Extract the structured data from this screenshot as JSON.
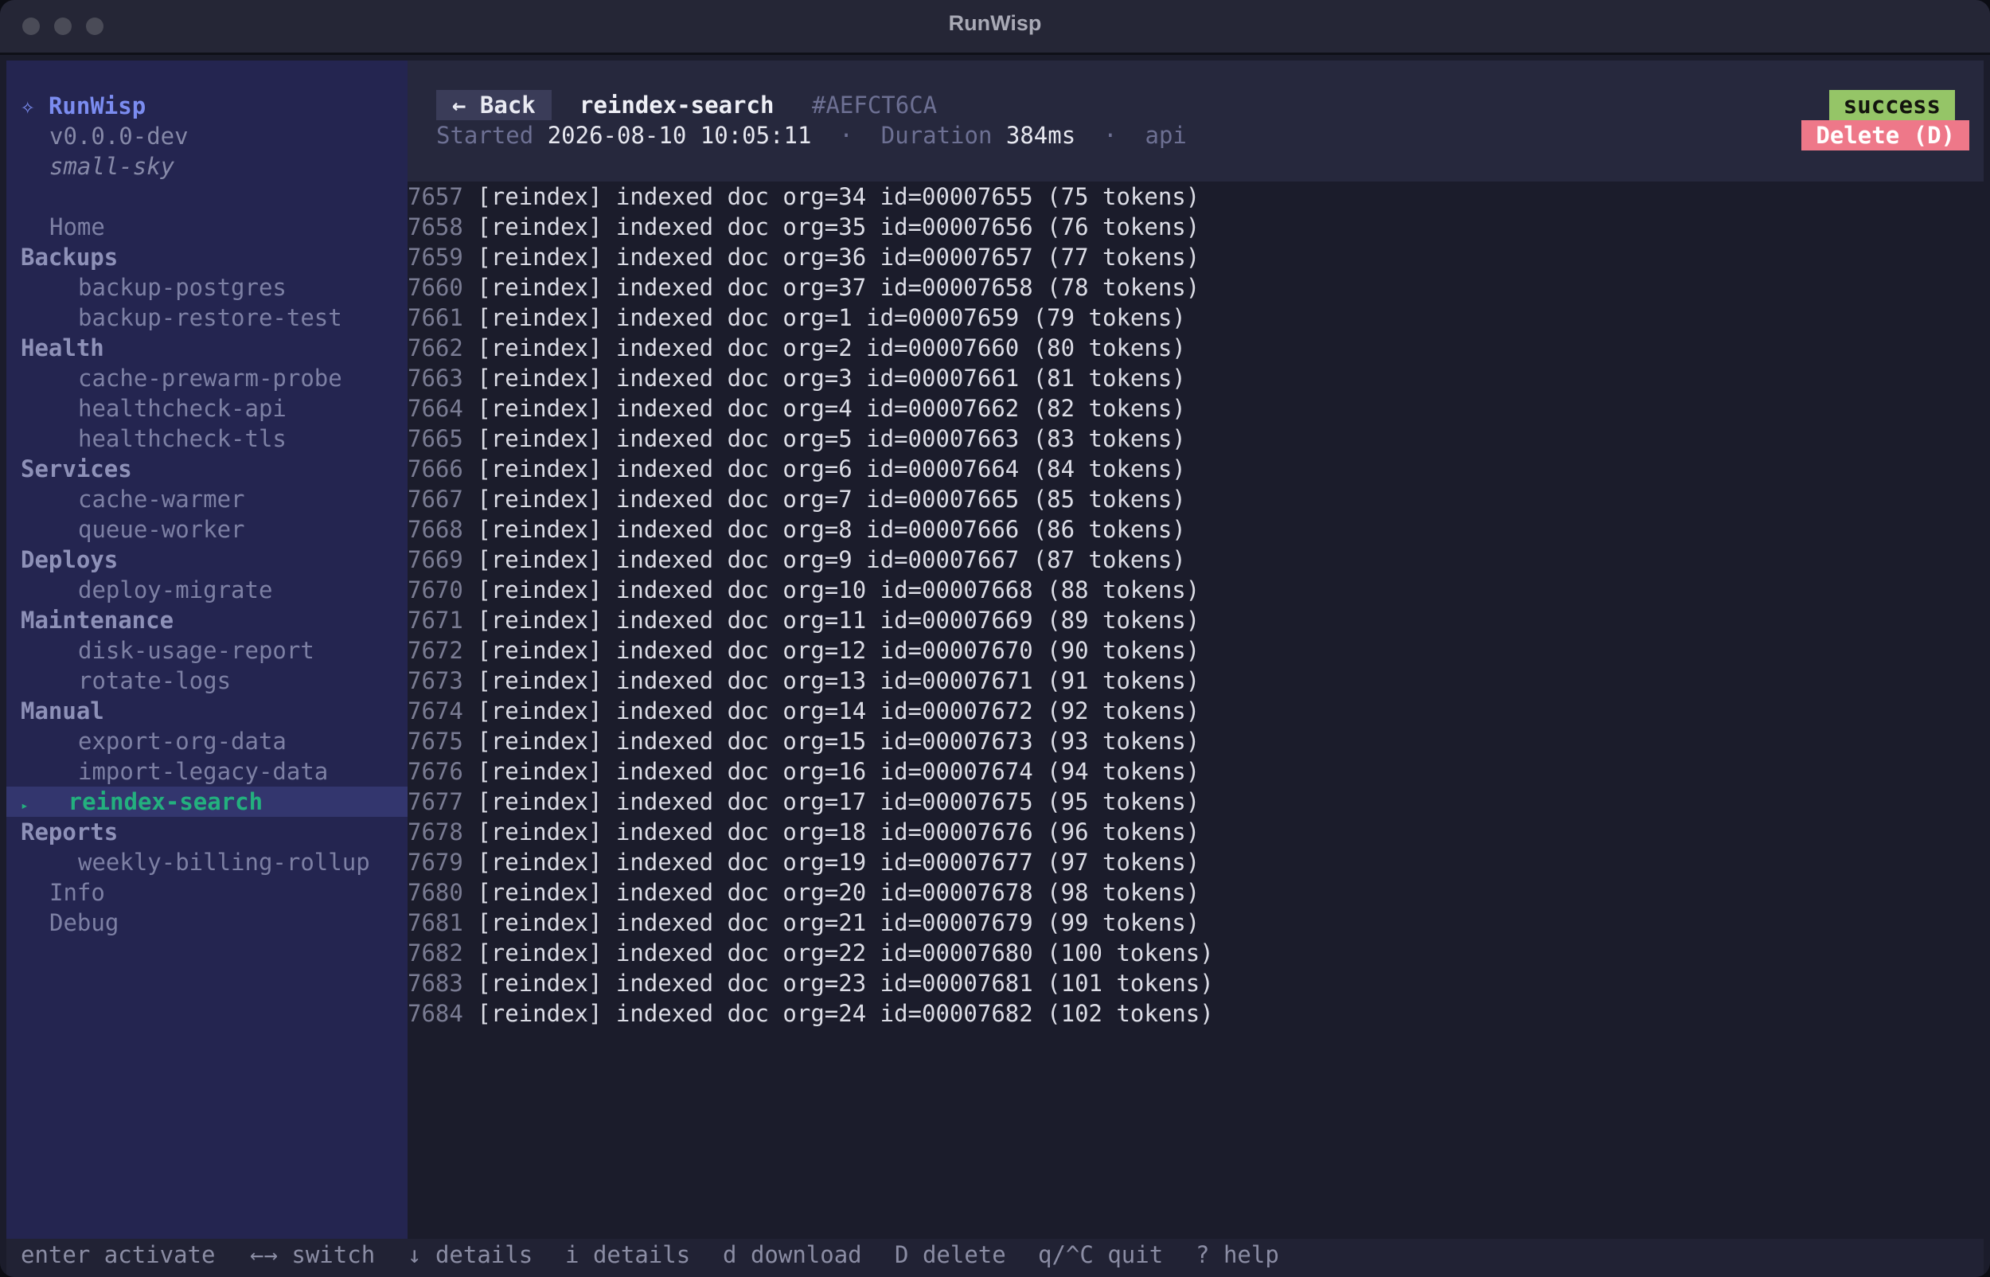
{
  "window": {
    "title": "RunWisp"
  },
  "sidebar": {
    "brand_icon": "✧",
    "brand": "RunWisp",
    "version": "v0.0.0-dev",
    "host": "small-sky",
    "home": "Home",
    "groups": [
      {
        "name": "Backups",
        "items": [
          "backup-postgres",
          "backup-restore-test"
        ]
      },
      {
        "name": "Health",
        "items": [
          "cache-prewarm-probe",
          "healthcheck-api",
          "healthcheck-tls"
        ]
      },
      {
        "name": "Services",
        "items": [
          "cache-warmer",
          "queue-worker"
        ]
      },
      {
        "name": "Deploys",
        "items": [
          "deploy-migrate"
        ]
      },
      {
        "name": "Maintenance",
        "items": [
          "disk-usage-report",
          "rotate-logs"
        ]
      },
      {
        "name": "Manual",
        "items": [
          "export-org-data",
          "import-legacy-data",
          "reindex-search"
        ]
      },
      {
        "name": "Reports",
        "items": [
          "weekly-billing-rollup"
        ]
      }
    ],
    "selected": "reindex-search",
    "selected_marker": "▸",
    "info": "Info",
    "debug": "Debug"
  },
  "header": {
    "back_label": "← Back",
    "job_name": "reindex-search",
    "run_id": "#AEFCT6CA",
    "started_label": "Started",
    "started_value": "2026-08-10 10:05:11",
    "separator": "·",
    "duration_label": "Duration",
    "duration_value": "384ms",
    "trigger": "api",
    "status": "success",
    "delete_label": "Delete (D)"
  },
  "colors": {
    "accent": "#7b8cf0",
    "success": "#95c567",
    "danger": "#ee7889",
    "selected_text": "#23b07e"
  },
  "log": [
    {
      "n": "7657",
      "text": "[reindex] indexed doc org=34 id=00007655 (75 tokens)"
    },
    {
      "n": "7658",
      "text": "[reindex] indexed doc org=35 id=00007656 (76 tokens)"
    },
    {
      "n": "7659",
      "text": "[reindex] indexed doc org=36 id=00007657 (77 tokens)"
    },
    {
      "n": "7660",
      "text": "[reindex] indexed doc org=37 id=00007658 (78 tokens)"
    },
    {
      "n": "7661",
      "text": "[reindex] indexed doc org=1 id=00007659 (79 tokens)"
    },
    {
      "n": "7662",
      "text": "[reindex] indexed doc org=2 id=00007660 (80 tokens)"
    },
    {
      "n": "7663",
      "text": "[reindex] indexed doc org=3 id=00007661 (81 tokens)"
    },
    {
      "n": "7664",
      "text": "[reindex] indexed doc org=4 id=00007662 (82 tokens)"
    },
    {
      "n": "7665",
      "text": "[reindex] indexed doc org=5 id=00007663 (83 tokens)"
    },
    {
      "n": "7666",
      "text": "[reindex] indexed doc org=6 id=00007664 (84 tokens)"
    },
    {
      "n": "7667",
      "text": "[reindex] indexed doc org=7 id=00007665 (85 tokens)"
    },
    {
      "n": "7668",
      "text": "[reindex] indexed doc org=8 id=00007666 (86 tokens)"
    },
    {
      "n": "7669",
      "text": "[reindex] indexed doc org=9 id=00007667 (87 tokens)"
    },
    {
      "n": "7670",
      "text": "[reindex] indexed doc org=10 id=00007668 (88 tokens)"
    },
    {
      "n": "7671",
      "text": "[reindex] indexed doc org=11 id=00007669 (89 tokens)"
    },
    {
      "n": "7672",
      "text": "[reindex] indexed doc org=12 id=00007670 (90 tokens)"
    },
    {
      "n": "7673",
      "text": "[reindex] indexed doc org=13 id=00007671 (91 tokens)"
    },
    {
      "n": "7674",
      "text": "[reindex] indexed doc org=14 id=00007672 (92 tokens)"
    },
    {
      "n": "7675",
      "text": "[reindex] indexed doc org=15 id=00007673 (93 tokens)"
    },
    {
      "n": "7676",
      "text": "[reindex] indexed doc org=16 id=00007674 (94 tokens)"
    },
    {
      "n": "7677",
      "text": "[reindex] indexed doc org=17 id=00007675 (95 tokens)"
    },
    {
      "n": "7678",
      "text": "[reindex] indexed doc org=18 id=00007676 (96 tokens)"
    },
    {
      "n": "7679",
      "text": "[reindex] indexed doc org=19 id=00007677 (97 tokens)"
    },
    {
      "n": "7680",
      "text": "[reindex] indexed doc org=20 id=00007678 (98 tokens)"
    },
    {
      "n": "7681",
      "text": "[reindex] indexed doc org=21 id=00007679 (99 tokens)"
    },
    {
      "n": "7682",
      "text": "[reindex] indexed doc org=22 id=00007680 (100 tokens)"
    },
    {
      "n": "7683",
      "text": "[reindex] indexed doc org=23 id=00007681 (101 tokens)"
    },
    {
      "n": "7684",
      "text": "[reindex] indexed doc org=24 id=00007682 (102 tokens)"
    }
  ],
  "statusbar": [
    {
      "key": "enter",
      "label": "activate"
    },
    {
      "key": "←→",
      "label": "switch"
    },
    {
      "key": "↓",
      "label": "details"
    },
    {
      "key": "i",
      "label": "details"
    },
    {
      "key": "d",
      "label": "download"
    },
    {
      "key": "D",
      "label": "delete"
    },
    {
      "key": "q/^C",
      "label": "quit"
    },
    {
      "key": "?",
      "label": "help"
    }
  ]
}
